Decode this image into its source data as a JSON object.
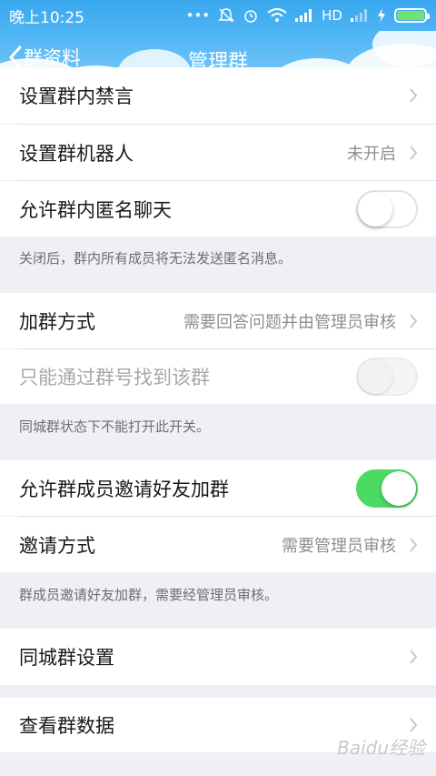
{
  "status_bar": {
    "time": "晚上10:25",
    "network_label": "HD"
  },
  "nav": {
    "back_label": "群资料",
    "title": "管理群"
  },
  "rows": {
    "mute": {
      "label": "设置群内禁言"
    },
    "robot": {
      "label": "设置群机器人",
      "value": "未开启"
    },
    "anonymous": {
      "label": "允许群内匿名聊天",
      "on": false
    },
    "join_method": {
      "label": "加群方式",
      "value": "需要回答问题并由管理员审核"
    },
    "search_by_number": {
      "label": "只能通过群号找到该群",
      "on": false,
      "disabled": true
    },
    "member_invite": {
      "label": "允许群成员邀请好友加群",
      "on": true
    },
    "invite_method": {
      "label": "邀请方式",
      "value": "需要管理员审核"
    },
    "city_group": {
      "label": "同城群设置"
    },
    "group_data": {
      "label": "查看群数据"
    }
  },
  "notes": {
    "anonymous": "关闭后，群内所有成员将无法发送匿名消息。",
    "city": "同城群状态下不能打开此开关。",
    "invite": "群成员邀请好友加群，需要经管理员审核。"
  },
  "watermark": "Baidu经验"
}
